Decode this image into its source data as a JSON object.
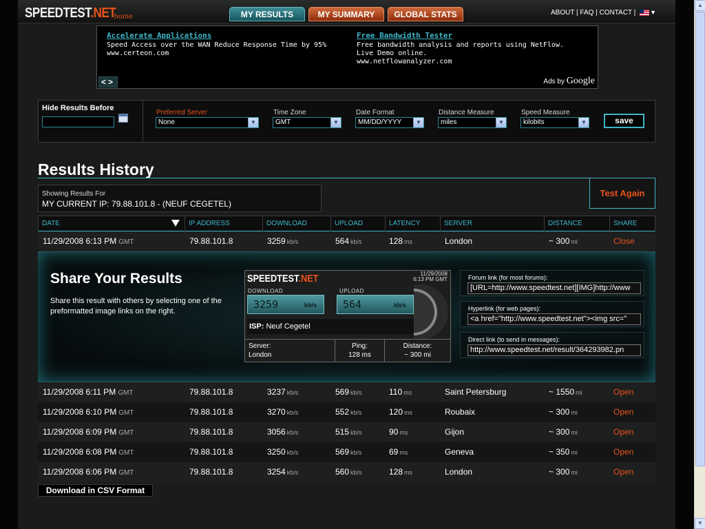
{
  "header": {
    "logo_main": "SPEEDTEST",
    "logo_net": ".NET",
    "home": "home",
    "tabs": [
      "MY RESULTS",
      "MY SUMMARY",
      "GLOBAL STATS"
    ],
    "links": "ABOUT | FAQ | CONTACT |"
  },
  "ads": {
    "ad1": {
      "title": "Accelerate Applications",
      "body": "Speed Access over the WAN Reduce Response Time by 95%",
      "url": "www.certeon.com"
    },
    "ad2": {
      "title": "Free Bandwidth Tester",
      "body": "Free bandwidth analysis and reports using NetFlow. Live Demo online.",
      "url": "www.netflowanalyzer.com"
    },
    "nav": "<>",
    "ads_by": "Ads by",
    "google": "Google"
  },
  "settings": {
    "hide_label": "Hide Results Before",
    "hide_value": "",
    "preferred_server_label": "Preferred Server",
    "preferred_server": "None",
    "timezone_label": "Time Zone",
    "timezone": "GMT",
    "date_format_label": "Date Format",
    "date_format": "MM/DD/YYYY",
    "distance_label": "Distance Measure",
    "distance": "miles",
    "speed_label": "Speed Measure",
    "speed": "kilobits",
    "save": "save"
  },
  "results": {
    "title": "Results History",
    "showing_label": "Showing Results For",
    "showing_value": "MY CURRENT IP: 79.88.101.8 - (NEUF CEGETEL)",
    "test_again": "Test Again",
    "columns": [
      "DATE",
      "IP ADDRESS",
      "DOWNLOAD",
      "UPLOAD",
      "LATENCY",
      "SERVER",
      "DISTANCE",
      "SHARE"
    ],
    "units": {
      "speed": "kb/s",
      "latency": "ms",
      "distance": "mi",
      "tz": "GMT"
    },
    "rows": [
      {
        "date": "11/29/2008 6:13 PM",
        "ip": "79.88.101.8",
        "download": "3259",
        "upload": "564",
        "latency": "128",
        "server": "London",
        "distance": "~ 300",
        "action": "Close"
      },
      {
        "date": "11/29/2008 6:11 PM",
        "ip": "79.88.101.8",
        "download": "3237",
        "upload": "569",
        "latency": "110",
        "server": "Saint Petersburg",
        "distance": "~ 1550",
        "action": "Open"
      },
      {
        "date": "11/29/2008 6:10 PM",
        "ip": "79.88.101.8",
        "download": "3270",
        "upload": "552",
        "latency": "120",
        "server": "Roubaix",
        "distance": "~ 300",
        "action": "Open"
      },
      {
        "date": "11/29/2008 6:09 PM",
        "ip": "79.88.101.8",
        "download": "3056",
        "upload": "515",
        "latency": "90",
        "server": "Gijon",
        "distance": "~ 300",
        "action": "Open"
      },
      {
        "date": "11/29/2008 6:08 PM",
        "ip": "79.88.101.8",
        "download": "3250",
        "upload": "569",
        "latency": "69",
        "server": "Geneva",
        "distance": "~ 350",
        "action": "Open"
      },
      {
        "date": "11/29/2008 6:06 PM",
        "ip": "79.88.101.8",
        "download": "3254",
        "upload": "560",
        "latency": "128",
        "server": "London",
        "distance": "~ 300",
        "action": "Open"
      }
    ]
  },
  "share": {
    "title": "Share Your Results",
    "desc": "Share this result with others by selecting one of the preformatted image links on the right.",
    "badge": {
      "logo_main": "SPEEDTEST",
      "logo_net": ".NET",
      "date": "11/29/2008",
      "time": "6:13 PM GMT",
      "download_label": "DOWNLOAD",
      "upload_label": "UPLOAD",
      "download": "3259",
      "upload": "564",
      "unit": "kb/s",
      "isp_label": "ISP:",
      "isp": "Neuf Cegetel",
      "server_label": "Server:",
      "server": "London",
      "ping_label": "Ping:",
      "ping": "128 ms",
      "distance_label": "Distance:",
      "distance": "~ 300 mi"
    },
    "forum_label": "Forum link (for most forums):",
    "forum_value": "[URL=http://www.speedtest.net][IMG]http://www",
    "hyperlink_label": "Hyperlink (for web pages):",
    "hyperlink_value": "<a href=\"http://www.speedtest.net\"><img src=\"",
    "direct_label": "Direct link (to send in messages):",
    "direct_value": "http://www.speedtest.net/result/364293982.pn"
  },
  "csv": "Download in CSV Format"
}
